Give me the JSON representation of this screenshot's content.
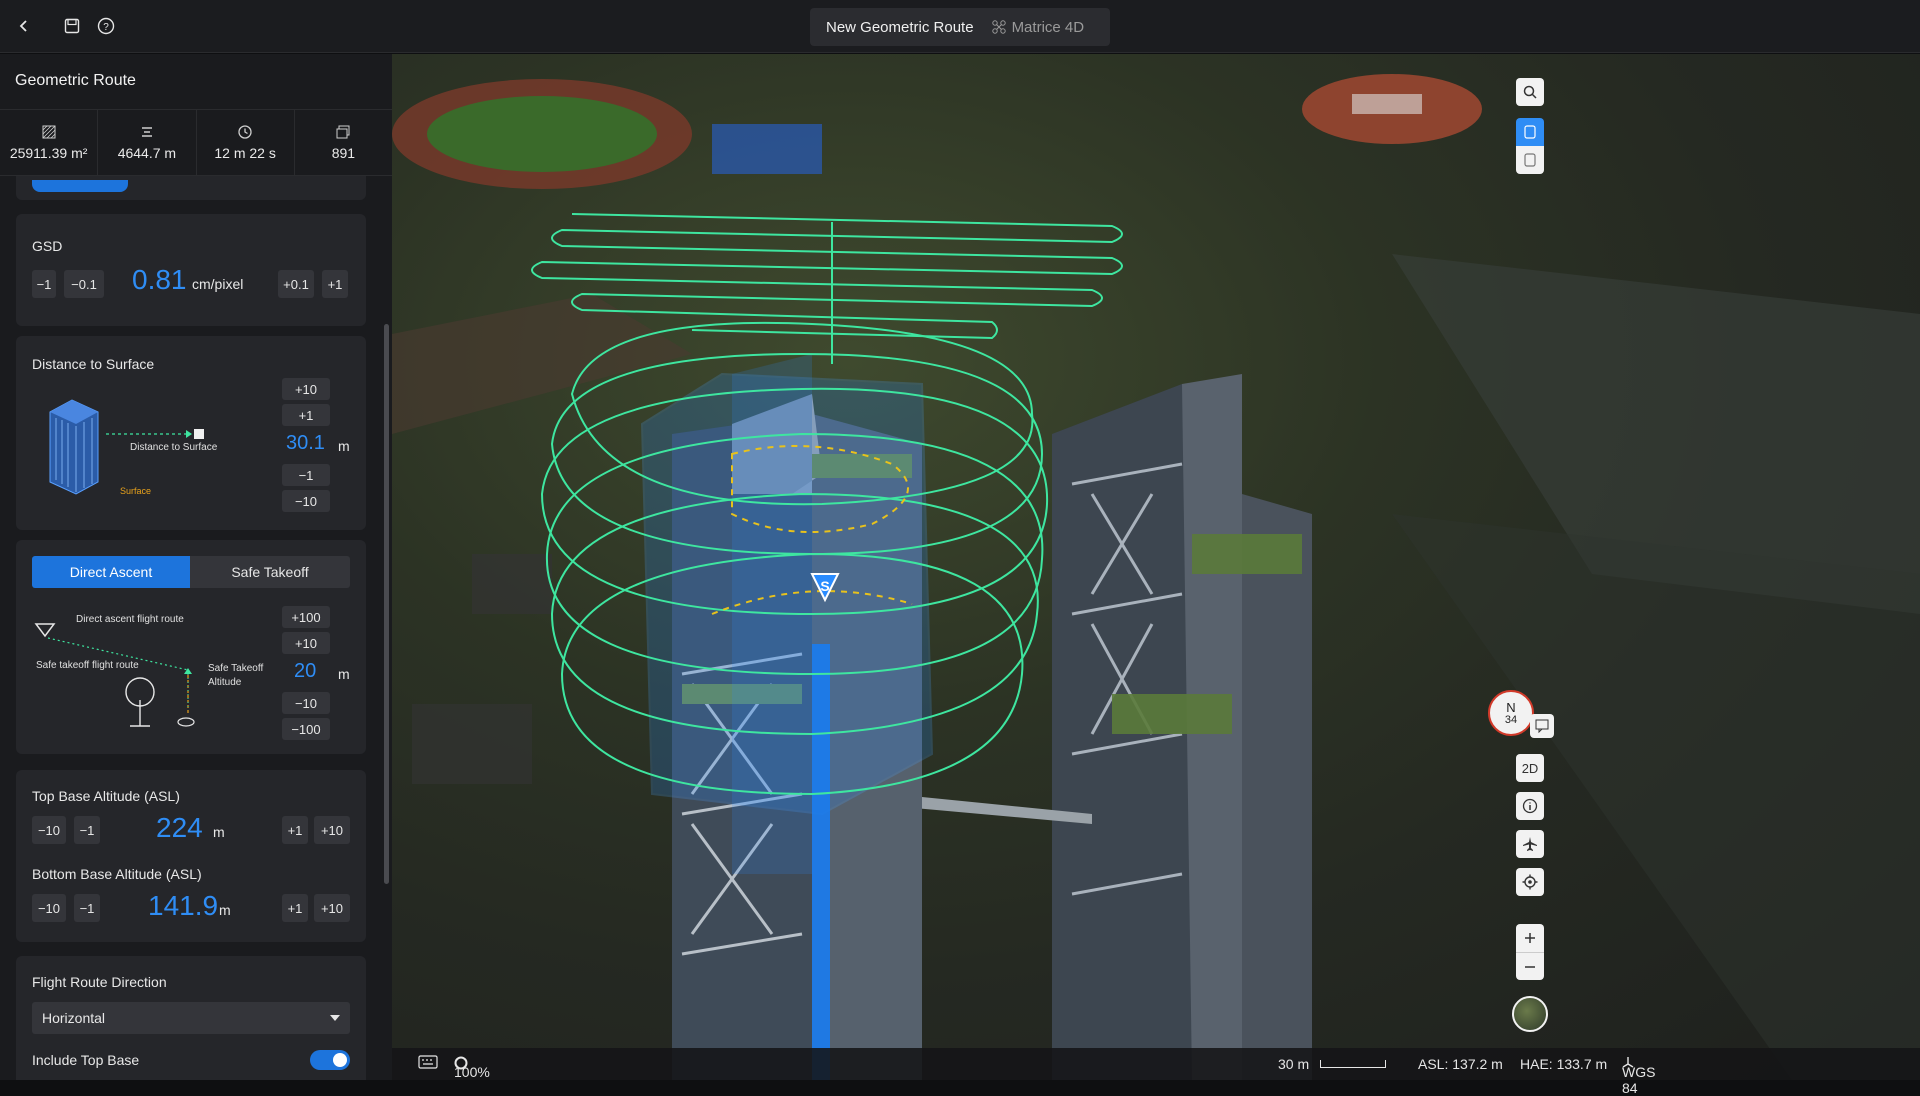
{
  "topbar": {
    "back_icon": "chevron-left-icon",
    "save_icon": "save-icon",
    "help_icon": "help-icon",
    "route_name": "New Geometric Route",
    "drone_model": "Matrice 4D",
    "drone_icon": "drone-icon"
  },
  "panel": {
    "title": "Geometric Route",
    "stats": [
      {
        "icon": "area-icon",
        "value": "25911.39 m²"
      },
      {
        "icon": "distance-icon",
        "value": "4644.7 m"
      },
      {
        "icon": "clock-icon",
        "value": "12 m 22 s"
      },
      {
        "icon": "photos-icon",
        "value": "891"
      }
    ]
  },
  "gsd": {
    "label": "GSD",
    "value": "0.81",
    "unit": "cm/pixel",
    "buttons": [
      "−1",
      "−0.1",
      "+0.1",
      "+1"
    ]
  },
  "distance": {
    "label": "Distance to Surface",
    "value": "30.1",
    "unit": "m",
    "diagram_label": "Distance to Surface",
    "surface_label": "Surface",
    "buttons_up": [
      "+10",
      "+1"
    ],
    "buttons_down": [
      "−1",
      "−10"
    ]
  },
  "takeoff": {
    "tabs": [
      "Direct Ascent",
      "Safe Takeoff"
    ],
    "active_tab": "Direct Ascent",
    "direct_label": "Direct ascent flight route",
    "safe_label": "Safe takeoff flight route",
    "safe_alt_label": "Safe Takeoff Altitude",
    "value": "20",
    "unit": "m",
    "buttons_up": [
      "+100",
      "+10"
    ],
    "buttons_down": [
      "−10",
      "−100"
    ]
  },
  "top_base": {
    "label": "Top Base Altitude (ASL)",
    "value": "224",
    "unit": "m",
    "buttons": [
      "−10",
      "−1",
      "+1",
      "+10"
    ]
  },
  "bottom_base": {
    "label": "Bottom Base Altitude (ASL)",
    "value": "141.9",
    "unit": "m",
    "buttons": [
      "−10",
      "−1",
      "+1",
      "+10"
    ]
  },
  "direction": {
    "label": "Flight Route Direction",
    "selected": "Horizontal",
    "include_top_label": "Include Top Base",
    "include_top": true
  },
  "map": {
    "compass_letter": "N",
    "compass_value": "34",
    "mode_2d": "2D",
    "start_marker": "S",
    "colors": {
      "route": "#3ee6a0",
      "accent": "#2f8df5",
      "volume": "#2a8cff"
    }
  },
  "status": {
    "keyboard_icon": "keyboard-icon",
    "opacity": "100%",
    "scale": "30 m",
    "asl": "ASL: 137.2 m",
    "hae": "HAE: 133.7 m",
    "datum": "WGS 84"
  }
}
